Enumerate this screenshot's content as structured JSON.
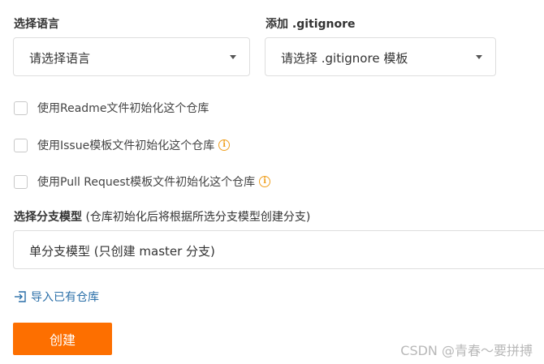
{
  "language": {
    "label": "选择语言",
    "select_value": "请选择语言"
  },
  "gitignore": {
    "label": "添加 .gitignore",
    "select_value": "请选择 .gitignore 模板"
  },
  "options": [
    {
      "label": "使用Readme文件初始化这个仓库",
      "checked": false,
      "has_info": false
    },
    {
      "label": "使用Issue模板文件初始化这个仓库",
      "checked": false,
      "has_info": true
    },
    {
      "label": "使用Pull Request模板文件初始化这个仓库",
      "checked": false,
      "has_info": true
    }
  ],
  "branch": {
    "label_strong": "选择分支模型",
    "label_hint": " (仓库初始化后将根据所选分支模型创建分支)",
    "select_value": "单分支模型 (只创建 master 分支)"
  },
  "import_link": "导入已有仓库",
  "create_button": "创建",
  "watermark": "CSDN @青春～要拼搏",
  "colors": {
    "accent": "#fd6f00",
    "link": "#2a6fa8",
    "info": "#f0a020"
  },
  "icons": {
    "info": "info-circle-icon",
    "import": "import-icon",
    "caret": "caret-down-icon"
  }
}
